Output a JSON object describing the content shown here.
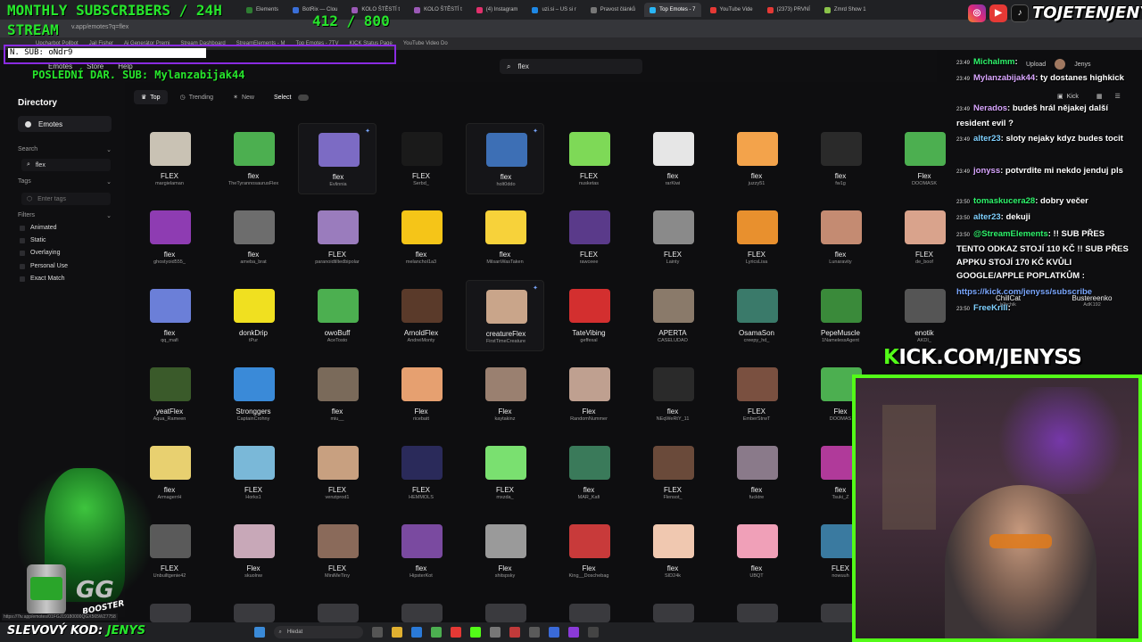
{
  "overlay": {
    "title_line1": "MONTHLY SUBSCRIBERS / 24H",
    "title_line2": "STREAM",
    "counter": "412 / 800",
    "new_sub": "N. SUB: oNdr9",
    "last_donation": "POSLEDNÍ DAR. SUB: Mylanzabijak44",
    "brand": "TOJETENJENYS",
    "kick_url_k": "K",
    "kick_url_rest": "ICK.COM/JENYSS",
    "discount_prefix": "SLEVOVÝ KOD:",
    "discount_code": "JENYS",
    "char_logo": "GG",
    "char_sub": "BOOSTER"
  },
  "browser": {
    "tabs": [
      {
        "label": "Elements",
        "color": "#2e7d32"
      },
      {
        "label": "BotRix — Clou",
        "color": "#3a6fd8"
      },
      {
        "label": "KOLO ŠTĚSTÍ t",
        "color": "#9b59b6"
      },
      {
        "label": "KOLO ŠTĚSTÍ t",
        "color": "#9b59b6"
      },
      {
        "label": "(4) Instagram",
        "color": "#e1306c"
      },
      {
        "label": "uzi.si – US si r",
        "color": "#1e88e5"
      },
      {
        "label": "Pravost článků",
        "color": "#777777"
      },
      {
        "label": "Top Emotes - 7",
        "color": "#29b6f6"
      },
      {
        "label": "YouTube Vide",
        "color": "#e53935"
      },
      {
        "label": "(2373) PRVNÍ",
        "color": "#e53935"
      },
      {
        "label": "Zmrd Show 1",
        "color": "#8bc34a"
      }
    ],
    "url": "v.app/emotes?q=flex",
    "bookmarks": [
      "Upcharbot Pollbot",
      "Jail Fisher",
      "Ai Generátor Premi",
      "Stream Dashboard",
      "StreamElements - M",
      "Top Emotes - 7TV",
      "KICK Status Page",
      "YouTube Video Do"
    ],
    "status_url": "https://7tv.app/emotes/01FGJ19180000QGX565WZ7758"
  },
  "site": {
    "nav": [
      "Emotes",
      "Store",
      "Help"
    ],
    "search_value": "flex",
    "upload_label": "Upload",
    "profile_name": "Jenys",
    "kick_label": "Kick"
  },
  "sidebar": {
    "title": "Directory",
    "emotes": "Emotes",
    "search_label": "Search",
    "search_value": "flex",
    "tags_label": "Tags",
    "tags_placeholder": "Enter tags",
    "filters_label": "Filters",
    "filters": [
      "Animated",
      "Static",
      "Overlaying",
      "Personal Use",
      "Exact Match"
    ]
  },
  "sortbar": {
    "top": "Top",
    "trending": "Trending",
    "new": "New",
    "select": "Select"
  },
  "grid": {
    "rows": [
      [
        {
          "name": "FLEX",
          "author": "margielaman",
          "color": "#c9c2b4"
        },
        {
          "name": "flex",
          "author": "TheTyrannosaurusFlex",
          "color": "#4caf50"
        },
        {
          "name": "flex",
          "author": "Evlinnia",
          "color": "#7c6bc4",
          "hl": true
        },
        {
          "name": "FLEX",
          "author": "Serbd_",
          "color": "#1a1a1a"
        },
        {
          "name": "flex",
          "author": "holt0ddo",
          "color": "#3d6fb5",
          "hl": true
        },
        {
          "name": "FLEX",
          "author": "nusketas",
          "color": "#7ed957"
        },
        {
          "name": "flex",
          "author": "rarKiwi",
          "color": "#e6e6e6"
        },
        {
          "name": "flex",
          "author": "juzzy51",
          "color": "#f3a34b"
        },
        {
          "name": "flex",
          "author": "fw1g",
          "color": "#2a2a2a"
        },
        {
          "name": "Flex",
          "author": "DOOMASK",
          "color": "#4caf50"
        }
      ],
      [
        {
          "name": "flex",
          "author": "ghostyoid555_",
          "color": "#8e3cb2"
        },
        {
          "name": "flex",
          "author": "ameba_brat",
          "color": "#6d6d6d"
        },
        {
          "name": "FLEX",
          "author": "paranoidtiltedbipolar",
          "color": "#9a7cbd"
        },
        {
          "name": "flex",
          "author": "melanchol1a3",
          "color": "#f5c518"
        },
        {
          "name": "flex",
          "author": "MilsanWasTaken",
          "color": "#f7d23a"
        },
        {
          "name": "FLEX",
          "author": "rawceee",
          "color": "#5a3a8a"
        },
        {
          "name": "FLEX",
          "author": "Lainty",
          "color": "#8a8a8a"
        },
        {
          "name": "FLEX",
          "author": "LyricsLisa",
          "color": "#e8902e"
        },
        {
          "name": "flex",
          "author": "Lunaravity",
          "color": "#c48b72"
        },
        {
          "name": "FLEX",
          "author": "de_boof",
          "color": "#d9a38c"
        }
      ],
      [
        {
          "name": "flex",
          "author": "qq_mafi",
          "color": "#6b7fd8"
        },
        {
          "name": "donkDrip",
          "author": "tPur",
          "color": "#f0e020"
        },
        {
          "name": "owoBuff",
          "author": "AceTosto",
          "color": "#4caf50"
        },
        {
          "name": "ArnoldFlex",
          "author": "AndreiMonty",
          "color": "#5a3a2a"
        },
        {
          "name": "creatureFlex",
          "author": "FirstTimeCreature",
          "color": "#c9a58a",
          "hl": true
        },
        {
          "name": "TateVibing",
          "author": "geffexal",
          "color": "#d32f2f"
        },
        {
          "name": "APERTA",
          "author": "CASELUDAO",
          "color": "#8a7a6a"
        },
        {
          "name": "OsamaSon",
          "author": "creepy_hd_",
          "color": "#3a7a6a"
        },
        {
          "name": "PepeMuscle",
          "author": "1NamelessAgent",
          "color": "#3a8a3a"
        },
        {
          "name": "enotik",
          "author": "AKDI_",
          "color": "#555555"
        }
      ],
      [
        {
          "name": "yeatFlex",
          "author": "Aqua_Rameen",
          "color": "#3a5a2a"
        },
        {
          "name": "Stronggers",
          "author": "CaptainCrohny",
          "color": "#3a8ad8"
        },
        {
          "name": "flex",
          "author": "miu__",
          "color": "#7a6a5a"
        },
        {
          "name": "Flex",
          "author": "ricebatt",
          "color": "#e6a070"
        },
        {
          "name": "Flex",
          "author": "kaytakinz",
          "color": "#9a8070"
        },
        {
          "name": "Flex",
          "author": "RandomNummer",
          "color": "#bfa090"
        },
        {
          "name": "flex",
          "author": "NEqWeRtY_11",
          "color": "#2a2a2a"
        },
        {
          "name": "FLEX",
          "author": "EmberStrwT",
          "color": "#7a5040"
        },
        {
          "name": "Flex",
          "author": "DOOMAS",
          "color": "#4caf50"
        }
      ],
      [
        {
          "name": "flex",
          "author": "ArmagerrH",
          "color": "#e8d070"
        },
        {
          "name": "FLEX",
          "author": "Horks1",
          "color": "#7ab8d8"
        },
        {
          "name": "FLEX",
          "author": "venziprod1",
          "color": "#c8a080"
        },
        {
          "name": "FLEX",
          "author": "HEMMOLS",
          "color": "#2a2a5a"
        },
        {
          "name": "FLEX",
          "author": "mxzda_",
          "color": "#7ae070"
        },
        {
          "name": "flex",
          "author": "MAR_Kafi",
          "color": "#3a7a5a"
        },
        {
          "name": "FLEX",
          "author": "Flensot_",
          "color": "#6a4a3a"
        },
        {
          "name": "flex",
          "author": "fucktre",
          "color": "#8a7a8a"
        },
        {
          "name": "flex",
          "author": "Tsuki_Z",
          "color": "#b03a9a"
        }
      ],
      [
        {
          "name": "FLEX",
          "author": "Unbuiltgenie42",
          "color": "#5a5a5a"
        },
        {
          "name": "Flex",
          "author": "skuolnw",
          "color": "#c8a8b8"
        },
        {
          "name": "FLEX",
          "author": "MiniMeTiny",
          "color": "#8a6a5a"
        },
        {
          "name": "flex",
          "author": "HipsterKot",
          "color": "#7a4aa0"
        },
        {
          "name": "Flex",
          "author": "shitspsky",
          "color": "#9a9a9a"
        },
        {
          "name": "Flex",
          "author": "King__Doschebag",
          "color": "#c83a3a"
        },
        {
          "name": "flex",
          "author": "SID24k",
          "color": "#f0c8b0"
        },
        {
          "name": "flex",
          "author": "UBQT",
          "color": "#f0a0b8"
        },
        {
          "name": "FLEX",
          "author": "nowuuh",
          "color": "#3a7aa0"
        }
      ]
    ],
    "chat_row_emotes": [
      {
        "name": "ChillCat",
        "author": "b3rchik"
      },
      {
        "name": "Bustereenko",
        "author": "AdK192"
      }
    ]
  },
  "chat": [
    {
      "time": "23:49",
      "user": "Michalmm",
      "text": ":",
      "cls": "u"
    },
    {
      "time": "23:49",
      "user": "Mylanzabijak44",
      "text": ": ty dostanes highkick",
      "cls": "u2"
    },
    {
      "time": "23:49",
      "user": "Nerados",
      "text": ": budeš hrál nějakej další resident evil ?",
      "cls": "u2"
    },
    {
      "time": "23:49",
      "user": "alter23",
      "text": ": sloty nejaky kdyz budes tocit",
      "cls": "u3"
    },
    {
      "time": "23:49",
      "user": "jonyss",
      "text": ": potvrdite mi nekdo jenduj pls",
      "cls": "u2"
    },
    {
      "time": "23:50",
      "user": "tomaskucera28",
      "text": ": dobry večer",
      "cls": "u"
    },
    {
      "time": "23:50",
      "user": "alter23",
      "text": ": dekuji",
      "cls": "u3"
    },
    {
      "time": "23:50",
      "user": "@StreamElements",
      "text": ": !! SUB PŘES TENTO ODKAZ STOJÍ 110 KČ !! SUB PŘES APPKU STOJÍ 170 KČ KVŮLI GOOGLE/APPLE POPLATKŮM :",
      "cls": "u"
    },
    {
      "time": "",
      "user": "",
      "text": "https://kick.com/jenyss/subscribe",
      "cls": "lk"
    },
    {
      "time": "23:50",
      "user": "FreeKrill",
      "text": ":",
      "cls": "u3"
    }
  ],
  "taskbar": {
    "search": "Hledat"
  },
  "colors": {
    "overlay_green": "#27e62c",
    "kick_green": "#53fc18",
    "sub_box_purple": "#8a2be2"
  }
}
